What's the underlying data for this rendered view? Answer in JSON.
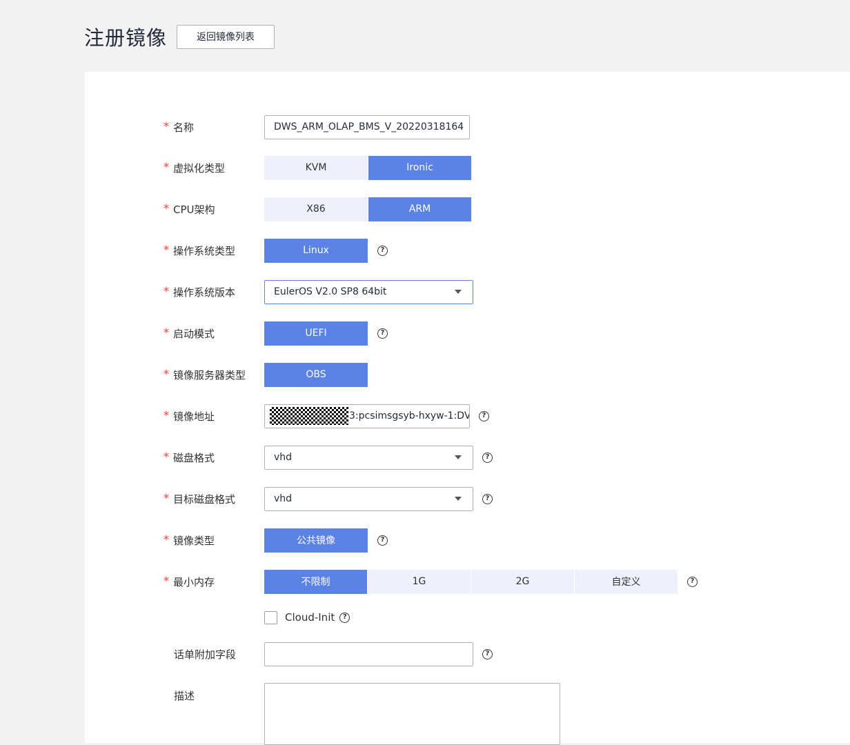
{
  "header": {
    "title": "注册镜像",
    "back_button": "返回镜像列表"
  },
  "form": {
    "name": {
      "label": "名称",
      "required": true,
      "value": "DWS_ARM_OLAP_BMS_V_20220318164"
    },
    "virtualization": {
      "label": "虚拟化类型",
      "required": true,
      "options": [
        "KVM",
        "Ironic"
      ],
      "selected": "Ironic"
    },
    "cpu_arch": {
      "label": "CPU架构",
      "required": true,
      "options": [
        "X86",
        "ARM"
      ],
      "selected": "ARM"
    },
    "os_type": {
      "label": "操作系统类型",
      "required": true,
      "options": [
        "Linux"
      ],
      "selected": "Linux"
    },
    "os_version": {
      "label": "操作系统版本",
      "required": true,
      "value": "EulerOS V2.0 SP8 64bit"
    },
    "boot_mode": {
      "label": "启动模式",
      "required": true,
      "options": [
        "UEFI"
      ],
      "selected": "UEFI"
    },
    "image_server_type": {
      "label": "镜像服务器类型",
      "required": true,
      "options": [
        "OBS"
      ],
      "selected": "OBS"
    },
    "image_address": {
      "label": "镜像地址",
      "required": true,
      "value_visible": "3:pcsimsgsyb-hxyw-1:DV"
    },
    "disk_format": {
      "label": "磁盘格式",
      "required": true,
      "value": "vhd"
    },
    "target_disk_format": {
      "label": "目标磁盘格式",
      "required": true,
      "value": "vhd"
    },
    "image_type": {
      "label": "镜像类型",
      "required": true,
      "options": [
        "公共镜像"
      ],
      "selected": "公共镜像"
    },
    "min_memory": {
      "label": "最小内存",
      "required": true,
      "options": [
        "不限制",
        "1G",
        "2G",
        "自定义"
      ],
      "selected": "不限制"
    },
    "cloud_init": {
      "label": "Cloud-Init",
      "checked": false
    },
    "ticket_field": {
      "label": "话单附加字段",
      "required": false,
      "value": ""
    },
    "description": {
      "label": "描述",
      "required": false,
      "value": ""
    }
  },
  "icons": {
    "help": "?",
    "dropdown": "caret-down-icon",
    "required_mark": "*"
  },
  "colors": {
    "accent": "#5b83e6",
    "segment_inactive": "#eef0fb",
    "required": "#e54545"
  }
}
